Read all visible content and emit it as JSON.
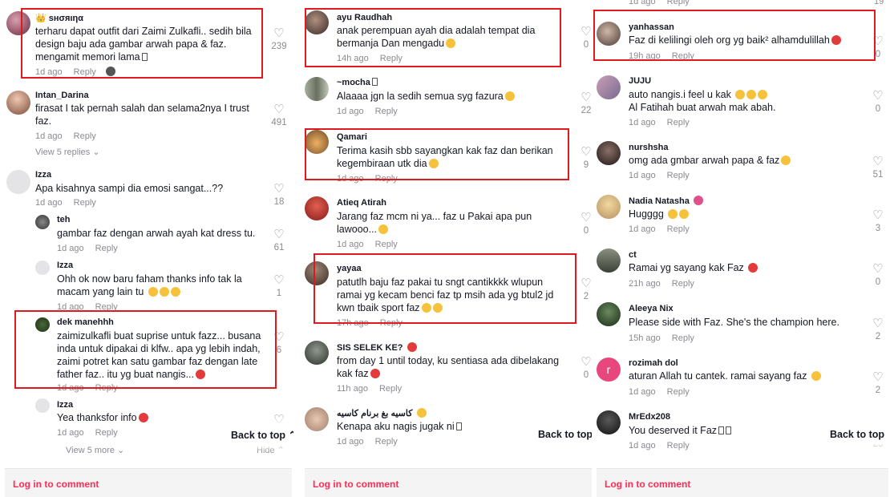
{
  "footer": {
    "login_label": "Log in to comment"
  },
  "back_to_top": "Back to top",
  "reply_label": "Reply",
  "col1": {
    "c1": {
      "user": "ѕнσяιηα",
      "text": "terharu dapat outfit dari Zaimi Zulkafli.. sedih bila design baju ada gambar arwah papa & faz. mengamit memori lama",
      "time": "1d ago",
      "likes": "239"
    },
    "c2": {
      "user": "Intan_Darina",
      "text": "firasat I tak pernah salah dan selama2nya I trust faz.",
      "time": "1d ago",
      "likes": "491",
      "view_replies": "View 5 replies ⌄"
    },
    "c3": {
      "user": "Izza",
      "text": "Apa kisahnya sampi dia emosi sangat...??",
      "time": "1d ago",
      "likes": "18"
    },
    "c3r1": {
      "user": "teh",
      "text": "gambar faz dengan arwah ayah kat dress tu.",
      "time": "1d ago",
      "likes": "61"
    },
    "c3r2": {
      "user": "Izza",
      "text": "Ohh ok now baru faham thanks info tak la macam yang lain tu",
      "time": "1d ago",
      "likes": "1"
    },
    "c3r3": {
      "user": "dek manehhh",
      "text": "zaimizulkafli buat suprise untuk fazz... busana inda untuk dipakai di klfw.. apa yg lebih indah, zaimi potret kan satu gambar faz dengan late father faz.. itu yg buat nangis...",
      "time": "1d ago",
      "likes": "6"
    },
    "c3r4": {
      "user": "Izza",
      "text": "Yea thanksfor info",
      "time": "1d ago"
    },
    "view_more": "View 5 more ⌄",
    "hide": "Hide ⌃"
  },
  "col2": {
    "c1": {
      "user": "ayu Raudhah",
      "text": "anak perempuan ayah dia adalah tempat dia bermanja Dan mengadu",
      "time": "14h ago",
      "likes": "0"
    },
    "c2": {
      "user": "~mocha",
      "text": "Alaaaa jgn la sedih semua syg fazura",
      "time": "1d ago",
      "likes": "22"
    },
    "c3": {
      "user": "Qamari",
      "text": "Terima kasih sbb sayangkan kak faz dan berikan kegembiraan utk dia",
      "time": "1d ago",
      "likes": "9"
    },
    "c4": {
      "user": "Atieq Atirah",
      "text": "Jarang faz mcm ni ya... faz u Pakai apa pun lawooo...",
      "time": "1d ago",
      "likes": "0"
    },
    "c5": {
      "user": "yayaa",
      "text": "patutlh baju faz pakai tu sngt cantikkkk wlupun ramai yg kecam benci faz tp msih ada yg btul2 jd kwn tbaik sport faz",
      "time": "17h ago",
      "likes": "2"
    },
    "c6": {
      "user": "SIS SELEK KE?",
      "text": "from day 1 until today, ku sentiasa ada dibelakang kak faz",
      "time": "11h ago",
      "likes": "0"
    },
    "c7": {
      "user": "كاسيه بغ برنام كاسيه",
      "text": "Kenapa aku nagis jugak ni",
      "time": "1d ago"
    }
  },
  "col3": {
    "top_meta": {
      "time": "1d ago",
      "likes": "19"
    },
    "c1": {
      "user": "yanhassan",
      "text": "Faz di kelilingi oleh org yg baik² alhamdulillah",
      "time": "19h ago",
      "likes": "0"
    },
    "c2": {
      "user": "JUJU",
      "text": "auto nangis.i feel u kak",
      "text2": "Al Fatihah buat arwah mak abah.",
      "time": "1d ago",
      "likes": "0"
    },
    "c3": {
      "user": "nurshsha",
      "text": "omg ada gmbar arwah papa & faz",
      "time": "1d ago",
      "likes": "51"
    },
    "c4": {
      "user": "Nadia Natasha",
      "text": "Hugggg",
      "time": "1d ago",
      "likes": "3"
    },
    "c5": {
      "user": "ct",
      "text": "Ramai yg sayang kak Faz",
      "time": "21h ago",
      "likes": "0"
    },
    "c6": {
      "user": "Aleeya Nix",
      "text": "Please side with Faz. She's the champion here.",
      "time": "15h ago",
      "likes": "2"
    },
    "c7": {
      "user": "rozimah dol",
      "text": "aturan Allah tu cantek. ramai sayang faz",
      "time": "1d ago",
      "likes": "2",
      "initial": "r"
    },
    "c8": {
      "user": "MrEdx208",
      "text": "You deserved it Faz",
      "time": "1d ago",
      "likes": "23"
    }
  },
  "colors": {
    "highlight": "#e0191f",
    "login": "#fe2c55",
    "muted": "#8a8b91"
  }
}
